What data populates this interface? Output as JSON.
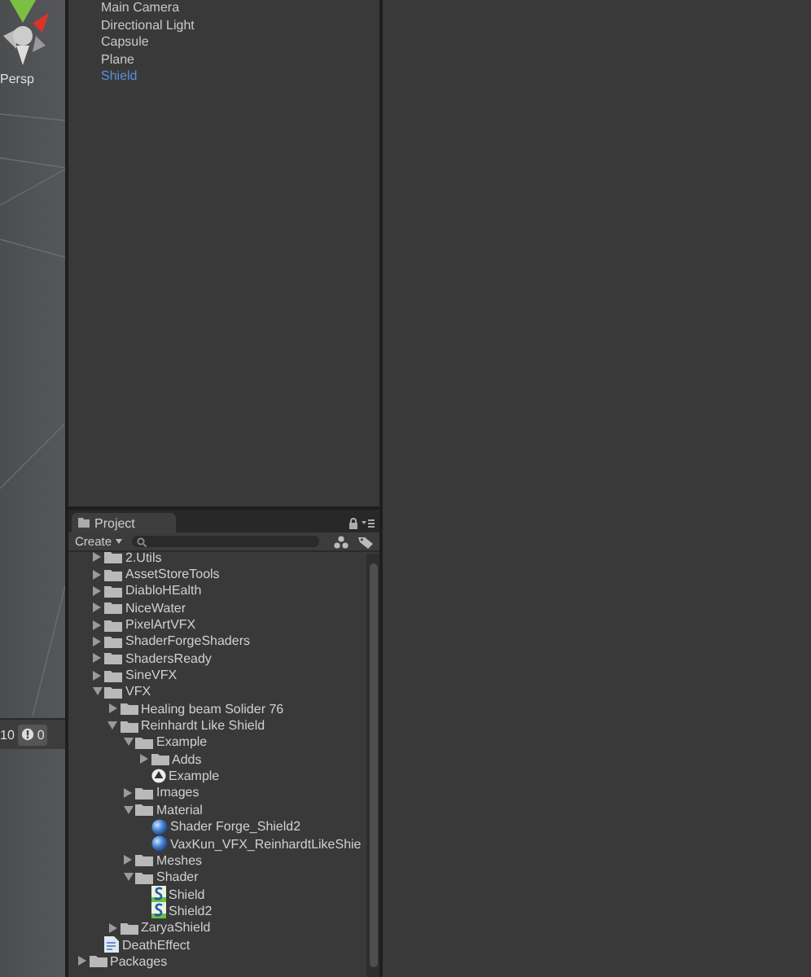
{
  "scene_view": {
    "camera_label": "Persp"
  },
  "console_counts": [
    {
      "kind": "log",
      "count": "10"
    },
    {
      "kind": "warning",
      "count": "0"
    }
  ],
  "hierarchy": {
    "items": [
      {
        "label": "Main Camera",
        "selected": false
      },
      {
        "label": "Directional Light",
        "selected": false
      },
      {
        "label": "Capsule",
        "selected": false
      },
      {
        "label": "Plane",
        "selected": false
      },
      {
        "label": "Shield",
        "selected": true
      }
    ]
  },
  "project": {
    "tab": "Project",
    "create_button": "Create",
    "tree": [
      {
        "label": "2.Utils",
        "kind": "folder",
        "expanded": false
      },
      {
        "label": "AssetStoreTools",
        "kind": "folder",
        "expanded": false
      },
      {
        "label": "DiabloHEalth",
        "kind": "folder",
        "expanded": false
      },
      {
        "label": "NiceWater",
        "kind": "folder",
        "expanded": false
      },
      {
        "label": "PixelArtVFX",
        "kind": "folder",
        "expanded": false
      },
      {
        "label": "ShaderForgeShaders",
        "kind": "folder",
        "expanded": false
      },
      {
        "label": "ShadersReady",
        "kind": "folder",
        "expanded": false
      },
      {
        "label": "SineVFX",
        "kind": "folder",
        "expanded": false
      },
      {
        "label": "VFX",
        "kind": "folder",
        "expanded": true,
        "children": [
          {
            "label": "Healing beam Solider 76",
            "kind": "folder",
            "expanded": false
          },
          {
            "label": "Reinhardt Like Shield",
            "kind": "folder",
            "expanded": true,
            "children": [
              {
                "label": "Example",
                "kind": "folder",
                "expanded": true,
                "children": [
                  {
                    "label": "Adds",
                    "kind": "folder",
                    "expanded": false
                  },
                  {
                    "label": "Example",
                    "kind": "scene"
                  }
                ]
              },
              {
                "label": "Images",
                "kind": "folder",
                "expanded": false
              },
              {
                "label": "Material",
                "kind": "folder",
                "expanded": true,
                "children": [
                  {
                    "label": "Shader Forge_Shield2",
                    "kind": "material"
                  },
                  {
                    "label": "VaxKun_VFX_ReinhardtLikeShie",
                    "kind": "material"
                  }
                ]
              },
              {
                "label": "Meshes",
                "kind": "folder",
                "expanded": false
              },
              {
                "label": "Shader",
                "kind": "folder",
                "expanded": true,
                "children": [
                  {
                    "label": "Shield",
                    "kind": "shader"
                  },
                  {
                    "label": "Shield2",
                    "kind": "shader"
                  }
                ]
              }
            ]
          },
          {
            "label": "ZaryaShield",
            "kind": "folder",
            "expanded": false
          }
        ]
      },
      {
        "label": "DeathEffect",
        "kind": "file"
      }
    ],
    "bottom_items": [
      {
        "label": "Packages",
        "kind": "folder",
        "expanded": false
      }
    ]
  }
}
